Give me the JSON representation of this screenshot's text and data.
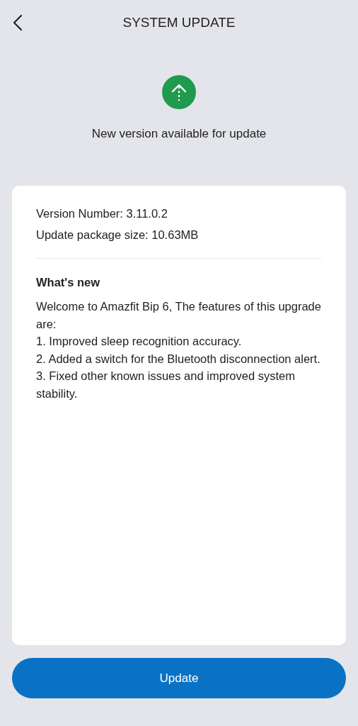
{
  "header": {
    "title": "SYSTEM UPDATE"
  },
  "status": {
    "message": "New version available for update"
  },
  "details": {
    "version": "Version Number: 3.11.0.2",
    "size": "Update package size: 10.63MB"
  },
  "whats_new": {
    "heading": "What's new",
    "lines": [
      "Welcome to Amazfit Bip 6, The features of this upgrade are:",
      "1. Improved sleep recognition accuracy.",
      "2. Added a switch for the Bluetooth disconnection alert.",
      "3. Fixed other known issues and improved system stability."
    ]
  },
  "button": {
    "label": "Update"
  }
}
